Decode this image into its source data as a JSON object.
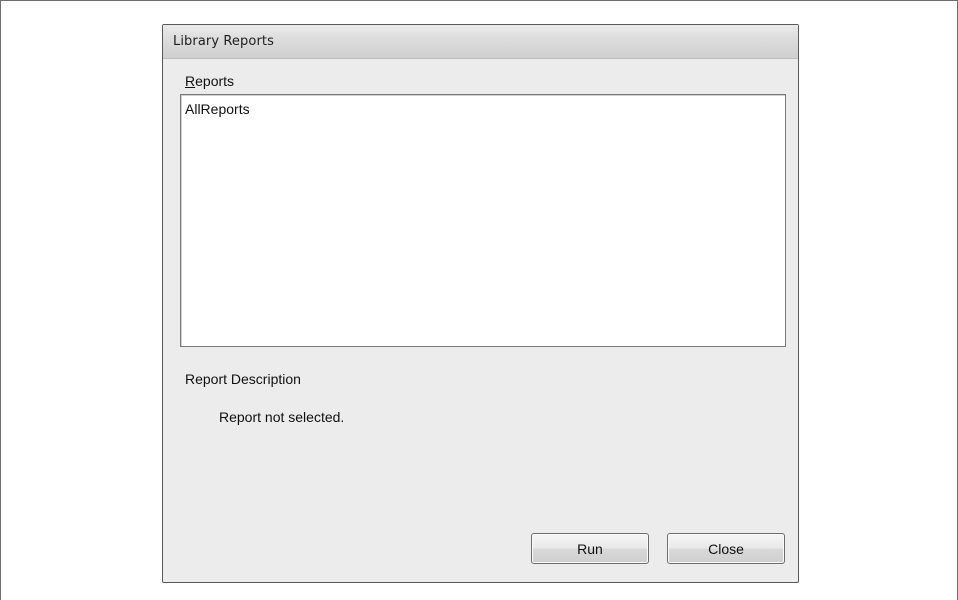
{
  "window": {
    "title": "Library Reports"
  },
  "reports": {
    "label_mnemonic": "R",
    "label_rest": "eports",
    "items": [
      "AllReports"
    ]
  },
  "description": {
    "heading": "Report Description",
    "text": "Report not selected."
  },
  "buttons": {
    "run": "Run",
    "close": "Close"
  }
}
